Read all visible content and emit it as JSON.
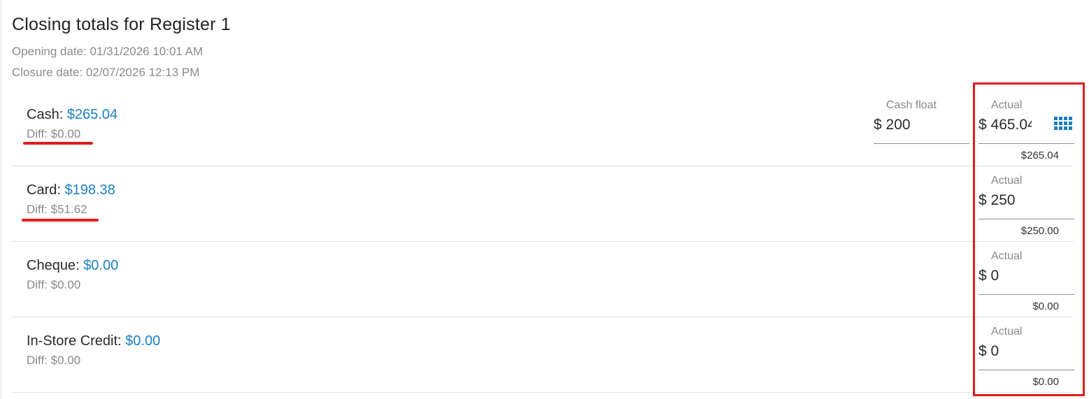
{
  "header": {
    "title": "Closing totals for Register 1",
    "opening_date": "Opening date: 01/31/2026 10:01 AM",
    "closure_date": "Closure date: 02/07/2026 12:13 PM"
  },
  "rows": [
    {
      "name": "Cash:",
      "amount": "$265.04",
      "diff": "Diff: $0.00",
      "float_label": "Cash float",
      "float_value": "$ 200",
      "actual_label": "Actual",
      "actual_value": "$ 465.04",
      "actual_sub": "$265.04"
    },
    {
      "name": "Card:",
      "amount": "$198.38",
      "diff": "Diff: $51.62",
      "actual_label": "Actual",
      "actual_value": "$ 250",
      "actual_sub": "$250.00"
    },
    {
      "name": "Cheque:",
      "amount": "$0.00",
      "diff": "Diff: $0.00",
      "actual_label": "Actual",
      "actual_value": "$ 0",
      "actual_sub": "$0.00"
    },
    {
      "name": "In-Store Credit:",
      "amount": "$0.00",
      "diff": "Diff: $0.00",
      "actual_label": "Actual",
      "actual_value": "$ 0",
      "actual_sub": "$0.00"
    }
  ],
  "icons": {
    "keypad": "keypad-grid-icon"
  },
  "colors": {
    "amount": "#1a7fc1",
    "annotation": "#e31b1b"
  }
}
